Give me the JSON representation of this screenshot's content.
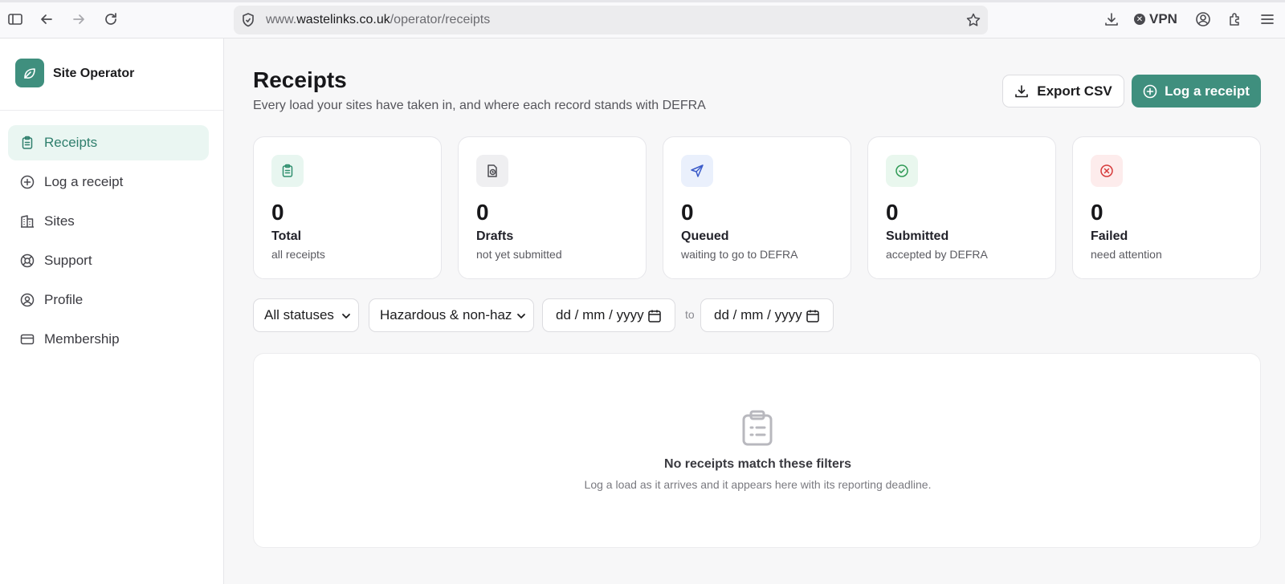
{
  "browser": {
    "url_prefix": "www.",
    "url_domain": "wastelinks.co.uk",
    "url_path": "/operator/receipts",
    "vpn_label": "VPN"
  },
  "sidebar": {
    "brand": "Site Operator",
    "items": [
      {
        "label": "Receipts",
        "icon": "clipboard-icon",
        "active": true
      },
      {
        "label": "Log a receipt",
        "icon": "plus-circle-icon",
        "active": false
      },
      {
        "label": "Sites",
        "icon": "building-icon",
        "active": false
      },
      {
        "label": "Support",
        "icon": "lifebuoy-icon",
        "active": false
      },
      {
        "label": "Profile",
        "icon": "user-circle-icon",
        "active": false
      },
      {
        "label": "Membership",
        "icon": "credit-card-icon",
        "active": false
      }
    ]
  },
  "main": {
    "title": "Receipts",
    "subtitle": "Every load your sites have taken in, and where each record stands with DEFRA",
    "export_label": "Export CSV",
    "log_label": "Log a receipt"
  },
  "stats": [
    {
      "count": "0",
      "label": "Total",
      "desc": "all receipts",
      "icon": "clipboard-icon",
      "color": "#2f8f6e",
      "bg": "#e8f6f0"
    },
    {
      "count": "0",
      "label": "Drafts",
      "desc": "not yet submitted",
      "icon": "file-clock-icon",
      "color": "#4a4a50",
      "bg": "#efeff1"
    },
    {
      "count": "0",
      "label": "Queued",
      "desc": "waiting to go to DEFRA",
      "icon": "send-icon",
      "color": "#3b5bc9",
      "bg": "#eaf0fc"
    },
    {
      "count": "0",
      "label": "Submitted",
      "desc": "accepted by DEFRA",
      "icon": "check-circle-icon",
      "color": "#2f9a55",
      "bg": "#e9f7ee"
    },
    {
      "count": "0",
      "label": "Failed",
      "desc": "need attention",
      "icon": "x-circle-icon",
      "color": "#d63a3a",
      "bg": "#fdecec"
    }
  ],
  "filters": {
    "status": "All statuses",
    "hazard": "Hazardous & non-haz",
    "date_from": "dd / mm / yyyy",
    "to_label": "to",
    "date_to": "dd / mm / yyyy"
  },
  "empty": {
    "title": "No receipts match these filters",
    "desc": "Log a load as it arrives and it appears here with its reporting deadline."
  }
}
